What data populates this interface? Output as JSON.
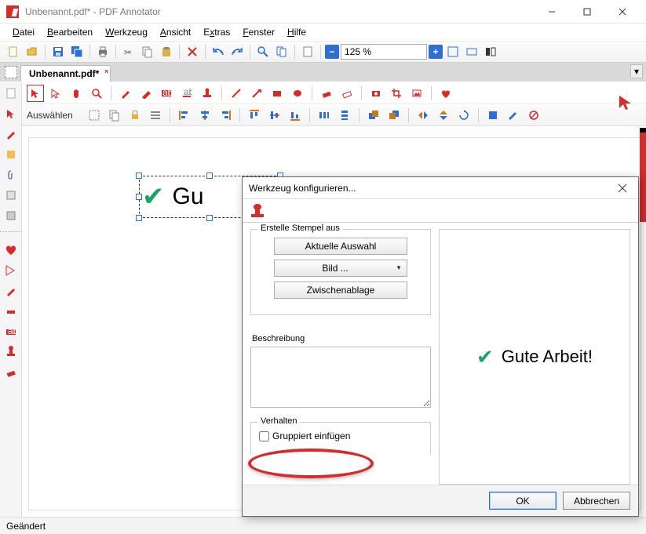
{
  "window": {
    "title": "Unbenannt.pdf* - PDF Annotator"
  },
  "menu": [
    "Datei",
    "Bearbeiten",
    "Werkzeug",
    "Ansicht",
    "Extras",
    "Fenster",
    "Hilfe"
  ],
  "zoom": {
    "value": "125 %"
  },
  "tab": {
    "label": "Unbenannt.pdf*"
  },
  "toolrow2": {
    "label": "Auswählen"
  },
  "selection": {
    "text": "Gu"
  },
  "status": {
    "text": "Geändert"
  },
  "dialog": {
    "title": "Werkzeug konfigurieren...",
    "fieldset_legend": "Erstelle Stempel aus",
    "btn_selection": "Aktuelle Auswahl",
    "btn_image": "Bild ...",
    "btn_clipboard": "Zwischenablage",
    "desc_label": "Beschreibung",
    "behave_legend": "Verhalten",
    "chk_label": "Gruppiert einfügen",
    "preview_text": "Gute Arbeit!",
    "ok": "OK",
    "cancel": "Abbrechen"
  },
  "icons": {
    "new": "new",
    "open": "open",
    "save": "save",
    "saveall": "saveall",
    "print": "print",
    "cut": "cut",
    "copy": "copy",
    "paste": "paste",
    "delete": "delete",
    "undo": "undo",
    "redo": "redo",
    "find": "find",
    "page": "page"
  }
}
